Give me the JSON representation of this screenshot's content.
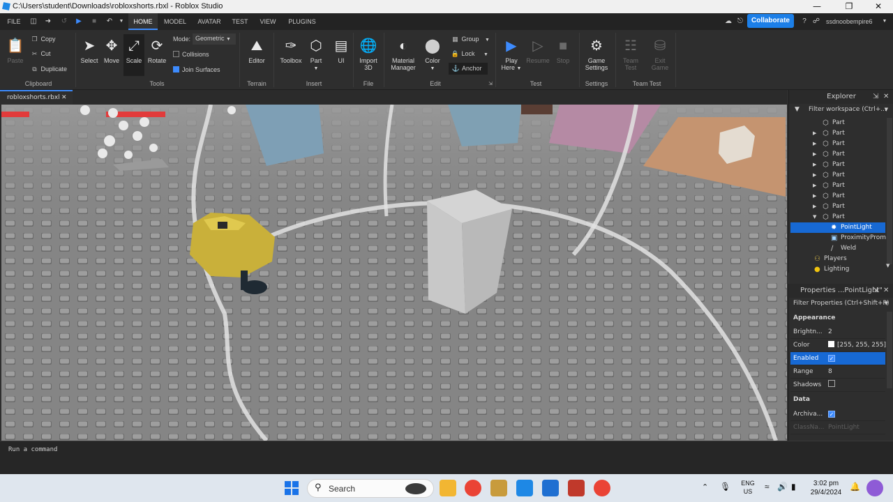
{
  "window": {
    "title": "C:\\Users\\student\\Downloads\\robloxshorts.rbxl - Roblox Studio"
  },
  "menubar": {
    "file": "FILE",
    "tabs": [
      "HOME",
      "MODEL",
      "AVATAR",
      "TEST",
      "VIEW",
      "PLUGINS"
    ],
    "active_tab": "HOME",
    "collaborate": "Collaborate",
    "username": "ssdnoobempire6"
  },
  "ribbon": {
    "clipboard": {
      "paste": "Paste",
      "copy": "Copy",
      "cut": "Cut",
      "duplicate": "Duplicate",
      "group": "Clipboard"
    },
    "tools": {
      "select": "Select",
      "move": "Move",
      "scale": "Scale",
      "rotate": "Rotate",
      "mode_label": "Mode:",
      "mode_value": "Geometric",
      "collisions": "Collisions",
      "collisions_checked": false,
      "join_surfaces": "Join Surfaces",
      "join_surfaces_checked": true,
      "group": "Tools"
    },
    "terrain": {
      "editor": "Editor",
      "group": "Terrain"
    },
    "insert": {
      "toolbox": "Toolbox",
      "part": "Part",
      "ui": "UI",
      "group": "Insert"
    },
    "file": {
      "import3d_line1": "Import",
      "import3d_line2": "3D",
      "group": "File"
    },
    "edit": {
      "material_line1": "Material",
      "material_line2": "Manager",
      "color": "Color",
      "group_btn": "Group",
      "lock": "Lock",
      "anchor": "Anchor",
      "group": "Edit"
    },
    "test": {
      "play_line1": "Play",
      "play_line2": "Here",
      "resume": "Resume",
      "stop": "Stop",
      "group": "Test"
    },
    "settings": {
      "game_line1": "Game",
      "game_line2": "Settings",
      "group": "Settings"
    },
    "team_test": {
      "team_line1": "Team",
      "team_line2": "Test",
      "exit_line1": "Exit",
      "exit_line2": "Game",
      "group": "Team Test"
    }
  },
  "document_tab": {
    "name": "robloxshorts.rbxl"
  },
  "explorer": {
    "title": "Explorer",
    "filter_placeholder": "Filter workspace (Ctrl+...",
    "items": [
      {
        "label": "Part",
        "type": "part",
        "indent": 1,
        "expand": "none"
      },
      {
        "label": "Part",
        "type": "part",
        "indent": 1,
        "expand": "collapsed"
      },
      {
        "label": "Part",
        "type": "part",
        "indent": 1,
        "expand": "collapsed"
      },
      {
        "label": "Part",
        "type": "part",
        "indent": 1,
        "expand": "collapsed"
      },
      {
        "label": "Part",
        "type": "part",
        "indent": 1,
        "expand": "collapsed"
      },
      {
        "label": "Part",
        "type": "part",
        "indent": 1,
        "expand": "collapsed"
      },
      {
        "label": "Part",
        "type": "part",
        "indent": 1,
        "expand": "collapsed"
      },
      {
        "label": "Part",
        "type": "part",
        "indent": 1,
        "expand": "collapsed"
      },
      {
        "label": "Part",
        "type": "part",
        "indent": 1,
        "expand": "collapsed"
      },
      {
        "label": "Part",
        "type": "part",
        "indent": 1,
        "expand": "expanded"
      },
      {
        "label": "PointLight",
        "type": "light",
        "indent": 2,
        "expand": "none",
        "selected": true
      },
      {
        "label": "ProximityProm",
        "type": "prompt",
        "indent": 2,
        "expand": "none"
      },
      {
        "label": "Weld",
        "type": "weld",
        "indent": 2,
        "expand": "none"
      },
      {
        "label": "Players",
        "type": "players",
        "indent": 0,
        "expand": "none"
      },
      {
        "label": "Lighting",
        "type": "lighting",
        "indent": 0,
        "expand": "none"
      }
    ]
  },
  "properties": {
    "title": "Properties ...PointLight\"",
    "filter_placeholder": "Filter Properties (Ctrl+Shift+P)",
    "appearance_header": "Appearance",
    "brightness_key": "Brightn...",
    "brightness_value": "2",
    "color_key": "Color",
    "color_value": "[255, 255, 255]",
    "enabled_key": "Enabled",
    "enabled_checked": true,
    "range_key": "Range",
    "range_value": "8",
    "shadows_key": "Shadows",
    "shadows_checked": false,
    "data_header": "Data",
    "archivable_key": "Archiva...",
    "archivable_checked": true,
    "classname_key": "ClassNa...",
    "classname_value": "PointLight"
  },
  "command_bar": {
    "placeholder": "Run a command"
  },
  "taskbar": {
    "search_placeholder": "Search",
    "lang_line1": "ENG",
    "lang_line2": "US",
    "time": "3:02 pm",
    "date": "29/4/2024"
  },
  "colors": {
    "accent": "#3d8bfd",
    "selection": "#1769d4",
    "collaborate": "#1c7fe8"
  }
}
